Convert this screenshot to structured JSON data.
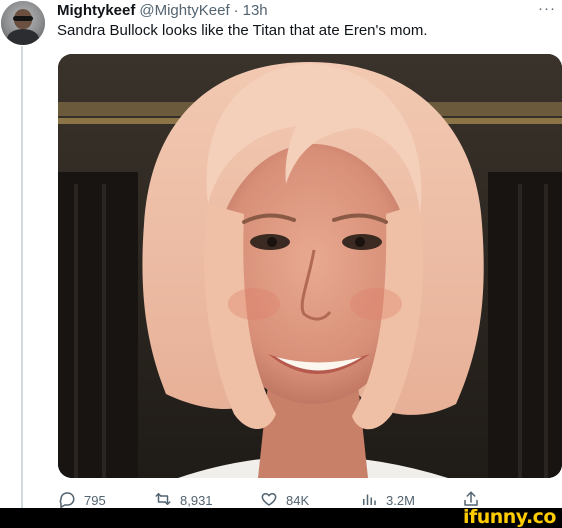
{
  "tweet": {
    "author_name": "Mightykeef",
    "author_handle": "@MightyKeef",
    "separator": "·",
    "time": "13h",
    "more_label": "···",
    "text": "Sandra Bullock looks like the Titan that ate Eren's mom."
  },
  "actions": {
    "replies": "795",
    "retweets": "8,931",
    "likes": "84K",
    "views": "3.2M",
    "icons": [
      "reply-icon",
      "retweet-icon",
      "like-icon",
      "views-icon",
      "share-icon"
    ]
  },
  "watermark": {
    "label": "ifunny.co",
    "color": "#ffcc00"
  },
  "colors": {
    "text_primary": "#0f1419",
    "text_secondary": "#536471",
    "thread_line": "#cfd9de"
  }
}
